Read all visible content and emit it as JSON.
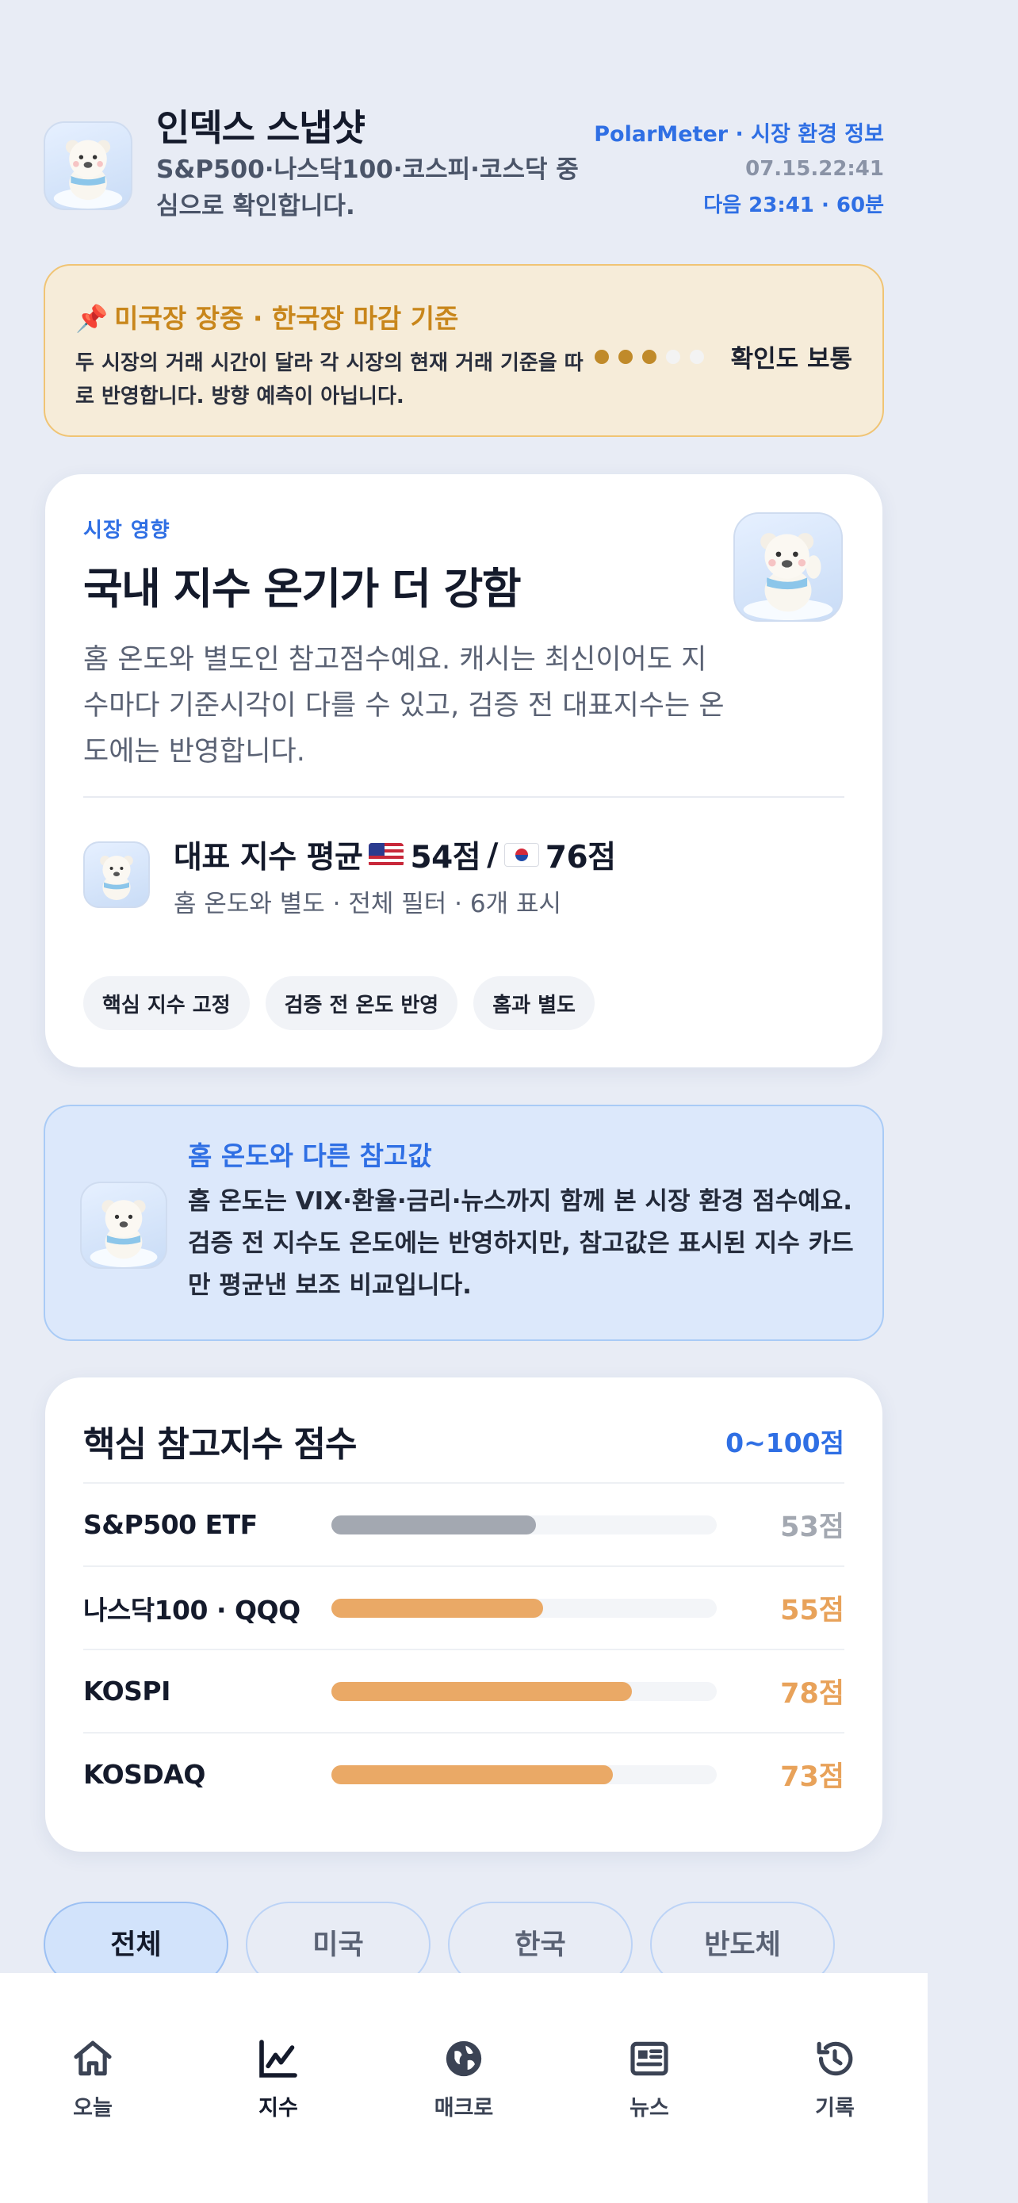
{
  "header": {
    "title": "인덱스 스냅샷",
    "subtitle": "S&P500·나스닥100·코스피·코스닥 중심으로 확인합니다.",
    "brand": "PolarMeter · 시장 환경 정보",
    "timestamp": "07.15.22:41",
    "next_update": "다음 23:41 · 60분"
  },
  "notice": {
    "icon": "pin-icon",
    "title": "미국장 장중 · 한국장 마감 기준",
    "body": "두 시장의 거래 시간이 달라 각 시장의 현재 거래 기준을 따로 반영합니다. 방향 예측이 아닙니다.",
    "confidence_level": 3,
    "confidence_max": 5,
    "confidence_label": "확인도 보통"
  },
  "impact": {
    "eyebrow": "시장 영향",
    "title": "국내 지수 온기가 더 강함",
    "description": "홈 온도와 별도인 참고점수예요. 캐시는 최신이어도 지수마다 기준시각이 다를 수 있고, 검증 전 대표지수는 온도에는 반영합니다.",
    "avg_prefix": "대표 지수 평균",
    "us_score": "54점",
    "separator": "/",
    "kr_score": "76점",
    "avg_sub": "홈 온도와 별도 · 전체 필터 · 6개 표시",
    "chips": [
      "핵심 지수 고정",
      "검증 전 온도 반영",
      "홈과 별도"
    ]
  },
  "info": {
    "title": "홈 온도와 다른 참고값",
    "body": "홈 온도는 VIX·환율·금리·뉴스까지 함께 본 시장 환경 점수예요. 검증 전 지수도 온도에는 반영하지만, 참고값은 표시된 지수 카드만 평균낸 보조 비교입니다."
  },
  "scores": {
    "title": "핵심 참고지수 점수",
    "range": "0~100점",
    "rows": [
      {
        "label": "S&P500 ETF",
        "value": 53,
        "score": "53점",
        "color": "#a3a8b1",
        "text_color": "#a3a8b1"
      },
      {
        "label": "나스닥100 · QQQ",
        "value": 55,
        "score": "55점",
        "color": "#eaa966",
        "text_color": "#e8a25a"
      },
      {
        "label": "KOSPI",
        "value": 78,
        "score": "78점",
        "color": "#eaa966",
        "text_color": "#e8a25a"
      },
      {
        "label": "KOSDAQ",
        "value": 73,
        "score": "73점",
        "color": "#eaa966",
        "text_color": "#e8a25a"
      }
    ]
  },
  "filters": {
    "tabs": [
      "전체",
      "미국",
      "한국",
      "반도체"
    ],
    "selected": "전체"
  },
  "nav": {
    "items": [
      {
        "label": "오늘",
        "icon": "home-icon"
      },
      {
        "label": "지수",
        "icon": "chart-icon"
      },
      {
        "label": "매크로",
        "icon": "globe-icon"
      },
      {
        "label": "뉴스",
        "icon": "news-icon"
      },
      {
        "label": "기록",
        "icon": "history-icon"
      }
    ],
    "selected": "지수"
  },
  "colors": {
    "accent": "#2f6fe4",
    "warn": "#c8861b",
    "bar_warm": "#eaa966",
    "bar_neutral": "#a3a8b1"
  }
}
